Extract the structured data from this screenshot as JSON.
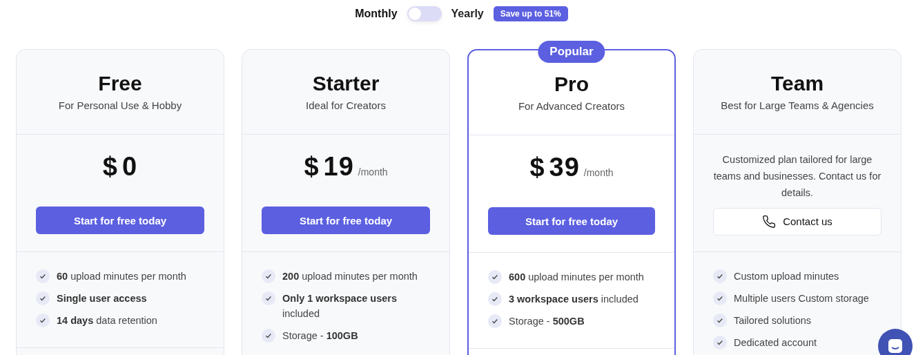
{
  "billing_toggle": {
    "monthly_label": "Monthly",
    "yearly_label": "Yearly",
    "on": false,
    "badge": "Save up to 51%"
  },
  "plans": [
    {
      "name": "Free",
      "subtitle": "For Personal Use & Hobby",
      "highlighted": false,
      "kind": "price",
      "currency": "$",
      "amount": "0",
      "cta": "Start for free today",
      "features": [
        "**60** upload minutes per month",
        "**Single user access**",
        "**14 days** data retention"
      ]
    },
    {
      "name": "Starter",
      "subtitle": "Ideal for Creators",
      "highlighted": false,
      "kind": "price",
      "currency": "$",
      "amount": "19",
      "period": "/month",
      "cta": "Start for free today",
      "features": [
        "**200** upload minutes per month",
        "**Only 1 workspace users** included",
        "Storage - **100GB**"
      ]
    },
    {
      "name": "Pro",
      "subtitle": "For Advanced Creators",
      "highlighted": true,
      "badge": "Popular",
      "kind": "price",
      "currency": "$",
      "amount": "39",
      "period": "/month",
      "cta": "Start for free today",
      "features": [
        "**600** upload minutes per month",
        "**3 workspace users** included",
        "Storage - **500GB**"
      ]
    },
    {
      "name": "Team",
      "subtitle": "Best for Large Teams & Agencies",
      "highlighted": false,
      "kind": "contact",
      "description": "Customized plan tailored for large teams and businesses. Contact us for details.",
      "cta": "Contact us",
      "features": [
        "Custom upload minutes",
        "Multiple users Custom storage",
        "Tailored solutions",
        "Dedicated account"
      ]
    }
  ]
}
